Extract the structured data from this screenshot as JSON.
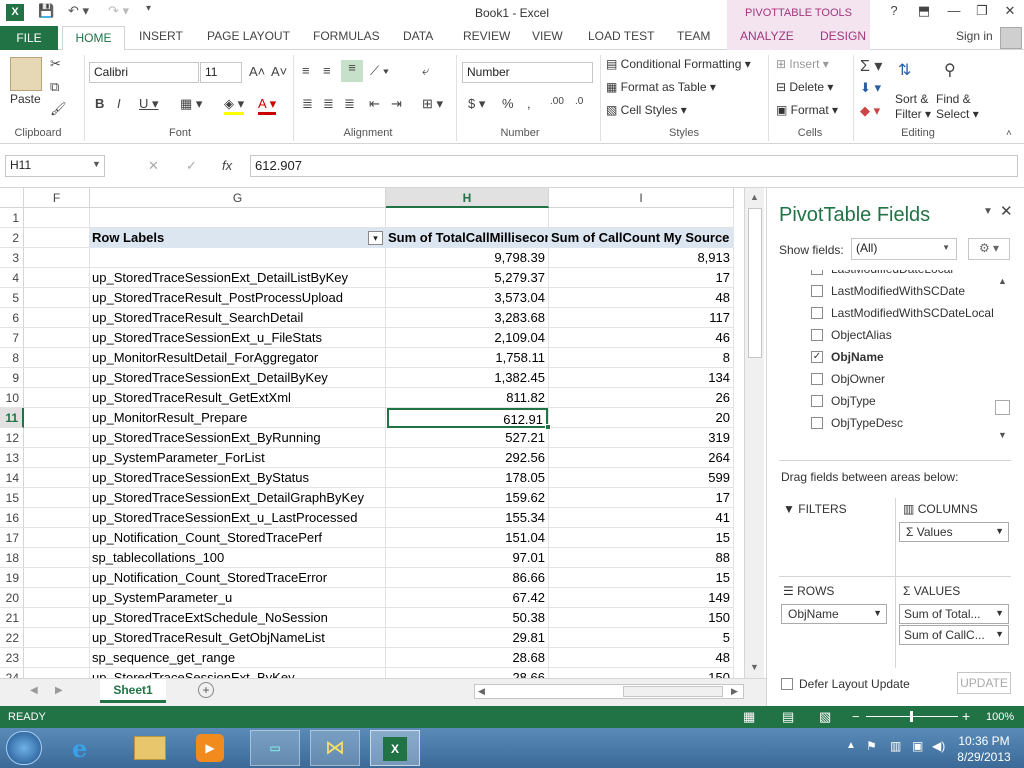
{
  "title": "Book1 - Excel",
  "pivot_tools": "PIVOTTABLE TOOLS",
  "window_buttons": [
    "?",
    "⬒",
    "—",
    "❐",
    "✕"
  ],
  "tabs": {
    "file": "FILE",
    "home": "HOME",
    "insert": "INSERT",
    "page_layout": "PAGE LAYOUT",
    "formulas": "FORMULAS",
    "data": "DATA",
    "review": "REVIEW",
    "view": "VIEW",
    "load_test": "LOAD TEST",
    "team": "TEAM",
    "analyze": "ANALYZE",
    "design": "DESIGN",
    "sign_in": "Sign in"
  },
  "ribbon": {
    "paste": "Paste",
    "clipboard": "Clipboard",
    "font_name": "Calibri",
    "font_size": "11",
    "font": "Font",
    "alignment": "Alignment",
    "number_format": "Number",
    "number": "Number",
    "conditional_formatting": "Conditional Formatting",
    "format_as_table": "Format as Table",
    "cell_styles": "Cell Styles",
    "styles": "Styles",
    "insert": "Insert",
    "delete": "Delete",
    "format": "Format",
    "cells": "Cells",
    "sort_filter": "Sort &",
    "sort_filter2": "Filter",
    "find_select": "Find &",
    "find_select2": "Select",
    "editing": "Editing"
  },
  "formula_bar": {
    "name_box": "H11",
    "fx": "fx",
    "value": "612.907"
  },
  "columns": [
    "F",
    "G",
    "H",
    "I"
  ],
  "rows": [
    "1",
    "2",
    "3",
    "4",
    "5",
    "6",
    "7",
    "8",
    "9",
    "10",
    "11",
    "12",
    "13",
    "14",
    "15",
    "16",
    "17",
    "18",
    "19",
    "20",
    "21",
    "22",
    "23",
    "24"
  ],
  "pivot": {
    "header_row_labels": "Row Labels",
    "header_h": "Sum of TotalCallMilliseconds",
    "header_i": "Sum of CallCount My Source",
    "records": [
      {
        "label": "",
        "ms": "9,798.39",
        "cnt": "8,913"
      },
      {
        "label": "up_StoredTraceSessionExt_DetailListByKey",
        "ms": "5,279.37",
        "cnt": "17"
      },
      {
        "label": "up_StoredTraceResult_PostProcessUpload",
        "ms": "3,573.04",
        "cnt": "48"
      },
      {
        "label": "up_StoredTraceResult_SearchDetail",
        "ms": "3,283.68",
        "cnt": "117"
      },
      {
        "label": "up_StoredTraceSessionExt_u_FileStats",
        "ms": "2,109.04",
        "cnt": "46"
      },
      {
        "label": "up_MonitorResultDetail_ForAggregator",
        "ms": "1,758.11",
        "cnt": "8"
      },
      {
        "label": "up_StoredTraceSessionExt_DetailByKey",
        "ms": "1,382.45",
        "cnt": "134"
      },
      {
        "label": "up_StoredTraceResult_GetExtXml",
        "ms": "811.82",
        "cnt": "26"
      },
      {
        "label": "up_MonitorResult_Prepare",
        "ms": "612.91",
        "cnt": "20"
      },
      {
        "label": "up_StoredTraceSessionExt_ByRunning",
        "ms": "527.21",
        "cnt": "319"
      },
      {
        "label": "up_SystemParameter_ForList",
        "ms": "292.56",
        "cnt": "264"
      },
      {
        "label": "up_StoredTraceSessionExt_ByStatus",
        "ms": "178.05",
        "cnt": "599"
      },
      {
        "label": "up_StoredTraceSessionExt_DetailGraphByKey",
        "ms": "159.62",
        "cnt": "17"
      },
      {
        "label": "up_StoredTraceSessionExt_u_LastProcessed",
        "ms": "155.34",
        "cnt": "41"
      },
      {
        "label": "up_Notification_Count_StoredTracePerf",
        "ms": "151.04",
        "cnt": "15"
      },
      {
        "label": "sp_tablecollations_100",
        "ms": "97.01",
        "cnt": "88"
      },
      {
        "label": "up_Notification_Count_StoredTraceError",
        "ms": "86.66",
        "cnt": "15"
      },
      {
        "label": "up_SystemParameter_u",
        "ms": "67.42",
        "cnt": "149"
      },
      {
        "label": "up_StoredTraceExtSchedule_NoSession",
        "ms": "50.38",
        "cnt": "150"
      },
      {
        "label": "up_StoredTraceResult_GetObjNameList",
        "ms": "29.81",
        "cnt": "5"
      },
      {
        "label": "sp_sequence_get_range",
        "ms": "28.68",
        "cnt": "48"
      },
      {
        "label": "up_StoredTraceSessionExt_ByKey",
        "ms": "28.66",
        "cnt": "150"
      }
    ]
  },
  "sheet_tab": "Sheet1",
  "status": {
    "ready": "READY",
    "zoom": "100%"
  },
  "pane": {
    "title": "PivotTable Fields",
    "show_fields": "Show fields:",
    "show_fields_value": "(All)",
    "fields": [
      {
        "name": "LastModifiedDateLocal",
        "checked": false
      },
      {
        "name": "LastModifiedWithSCDate",
        "checked": false
      },
      {
        "name": "LastModifiedWithSCDateLocal",
        "checked": false
      },
      {
        "name": "ObjectAlias",
        "checked": false
      },
      {
        "name": "ObjName",
        "checked": true
      },
      {
        "name": "ObjOwner",
        "checked": false
      },
      {
        "name": "ObjType",
        "checked": false
      },
      {
        "name": "ObjTypeDesc",
        "checked": false
      }
    ],
    "drag_hint": "Drag fields between areas below:",
    "filters": "FILTERS",
    "columns": "COLUMNS",
    "rows": "ROWS",
    "values": "VALUES",
    "columns_item": "Values",
    "rows_item": "ObjName",
    "values_items": [
      "Sum of Total...",
      "Sum of CallC..."
    ],
    "defer": "Defer Layout Update",
    "update": "UPDATE"
  },
  "taskbar": {
    "time": "10:36 PM",
    "date": "8/29/2013"
  }
}
